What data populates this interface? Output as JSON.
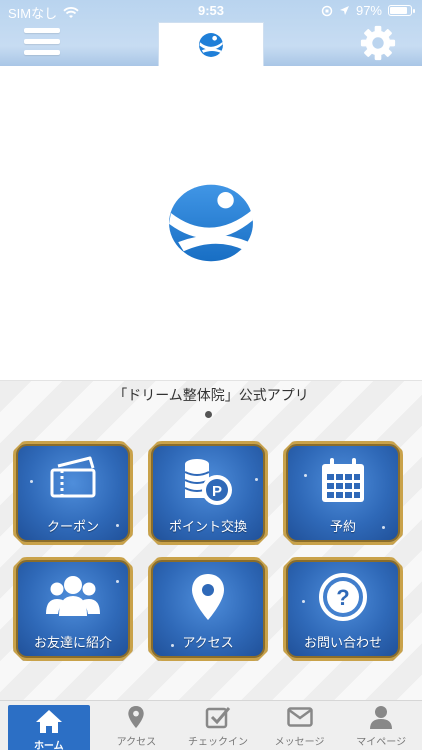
{
  "status_bar": {
    "carrier": "SIMなし",
    "time": "9:53",
    "battery": "97%"
  },
  "app": {
    "title": "「ドリーム整体院」公式アプリ"
  },
  "tiles": [
    {
      "label": "クーポン",
      "icon": "ticket-icon"
    },
    {
      "label": "ポイント交換",
      "icon": "coins-icon"
    },
    {
      "label": "予約",
      "icon": "calendar-icon"
    },
    {
      "label": "お友達に紹介",
      "icon": "users-icon"
    },
    {
      "label": "アクセス",
      "icon": "map-pin-icon"
    },
    {
      "label": "お問い合わせ",
      "icon": "question-icon"
    }
  ],
  "bottom_nav": [
    {
      "label": "ホーム",
      "icon": "home-icon",
      "active": true
    },
    {
      "label": "アクセス",
      "icon": "map-pin-icon"
    },
    {
      "label": "チェックイン",
      "icon": "checkin-icon"
    },
    {
      "label": "メッセージ",
      "icon": "mail-icon"
    },
    {
      "label": "マイページ",
      "icon": "person-icon"
    }
  ],
  "colors": {
    "header": "#b9d4ef",
    "tile": "#2f69b8",
    "tile_border": "#c9a24a",
    "nav_active": "#2c6fc5"
  }
}
